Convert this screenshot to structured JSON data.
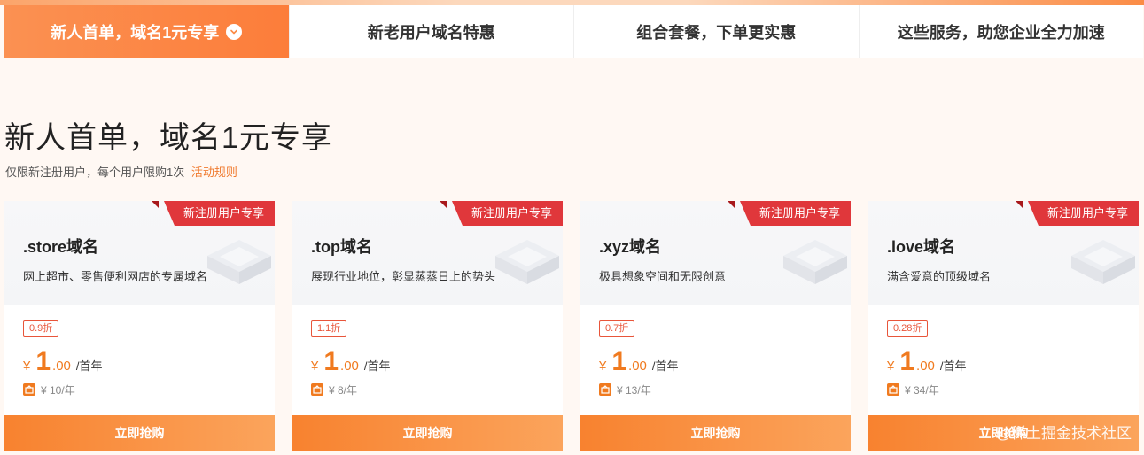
{
  "tabs": [
    {
      "label": "新人首单，域名1元专享"
    },
    {
      "label": "新老用户域名特惠"
    },
    {
      "label": "组合套餐，下单更实惠"
    },
    {
      "label": "这些服务，助您企业全力加速"
    }
  ],
  "section": {
    "title": "新人首单，域名1元专享",
    "subtitle": "仅限新注册用户，每个用户限购1次",
    "rules_link": "活动规则"
  },
  "cards": [
    {
      "ribbon": "新注册用户专享",
      "name": ".store域名",
      "desc": "网上超市、零售便利网店的专属域名",
      "discount": "0.9折",
      "currency": "¥",
      "price_int": "1",
      "price_dec": ".00",
      "unit": "/首年",
      "original": "¥ 10/年",
      "button": "立即抢购"
    },
    {
      "ribbon": "新注册用户专享",
      "name": ".top域名",
      "desc": "展现行业地位，彰显蒸蒸日上的势头",
      "discount": "1.1折",
      "currency": "¥",
      "price_int": "1",
      "price_dec": ".00",
      "unit": "/首年",
      "original": "¥ 8/年",
      "button": "立即抢购"
    },
    {
      "ribbon": "新注册用户专享",
      "name": ".xyz域名",
      "desc": "极具想象空间和无限创意",
      "discount": "0.7折",
      "currency": "¥",
      "price_int": "1",
      "price_dec": ".00",
      "unit": "/首年",
      "original": "¥ 13/年",
      "button": "立即抢购"
    },
    {
      "ribbon": "新注册用户专享",
      "name": ".love域名",
      "desc": "满含爱意的顶级域名",
      "discount": "0.28折",
      "currency": "¥",
      "price_int": "1",
      "price_dec": ".00",
      "unit": "/首年",
      "original": "¥ 34/年",
      "button": "立即抢购"
    }
  ],
  "watermark": "@稀土掘金技术社区",
  "colors": {
    "accent": "#f07a1f",
    "ribbon": "#e0373b",
    "background": "#fff8f3"
  }
}
